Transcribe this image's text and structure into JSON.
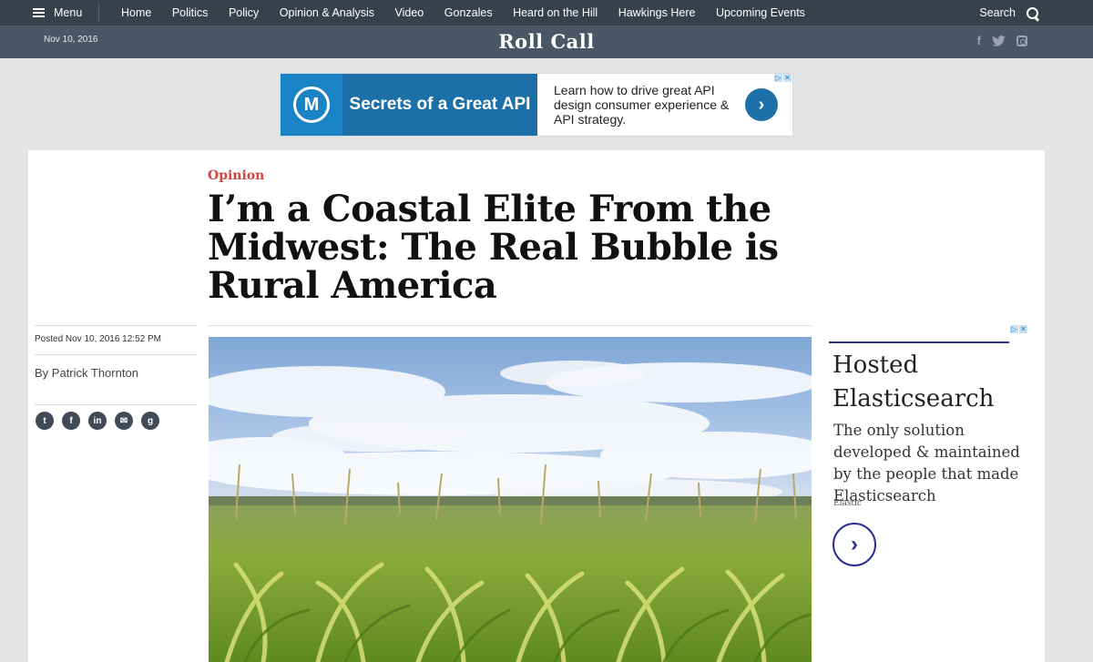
{
  "nav": {
    "menu_label": "Menu",
    "links": [
      "Home",
      "Politics",
      "Policy",
      "Opinion & Analysis",
      "Video",
      "Gonzales",
      "Heard on the Hill",
      "Hawkings Here",
      "Upcoming Events"
    ],
    "search_label": "Search"
  },
  "brand": {
    "date": "Nov 10, 2016",
    "logo": "Roll Call",
    "social": {
      "facebook": "f",
      "twitter": "t"
    }
  },
  "top_ad": {
    "logo_letter": "M",
    "headline": "Secrets of a Great API",
    "copy": "Learn how to drive great API design consumer experience & API strategy."
  },
  "article": {
    "kicker": "Opinion",
    "title": "I’m a Coastal Elite From the Midwest: The Real Bubble is Rural America",
    "posted": "Posted Nov 10, 2016 12:52 PM",
    "byline": "By Patrick Thornton",
    "share": {
      "twitter": "t",
      "facebook": "f",
      "linkedin": "in",
      "email": "✉",
      "google": "g"
    }
  },
  "side_ad": {
    "title": "Hosted Elasticsearch",
    "text": "The only solution developed & maintained by the people that made Elasticsearch",
    "sponsor": "Elastic"
  },
  "colors": {
    "nav_bg": "#38404c",
    "brand_bg": "#4a5566",
    "kicker": "#d2453d",
    "ad_blue": "#1d6fa8",
    "elastic_blue": "#2b2f8f"
  }
}
